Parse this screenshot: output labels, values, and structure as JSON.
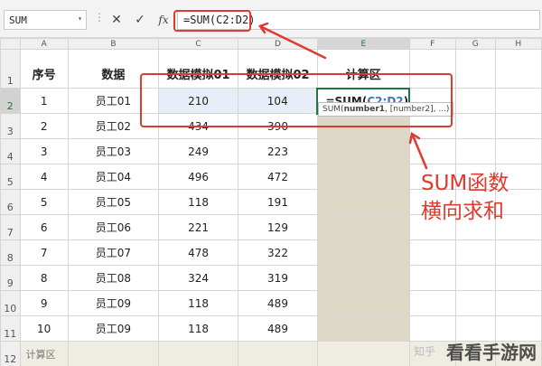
{
  "name_box": {
    "value": "SUM",
    "dropdown_icon": "▾"
  },
  "formula_bar": {
    "separator": "⋮",
    "cancel_icon": "✕",
    "enter_icon": "✓",
    "fx_icon": "fx",
    "formula": "=SUM(C2:D2)"
  },
  "columns": [
    "A",
    "B",
    "C",
    "D",
    "E",
    "F",
    "G",
    "H"
  ],
  "row_numbers": [
    "1",
    "2",
    "3",
    "4",
    "5",
    "6",
    "7",
    "8",
    "9",
    "10",
    "11"
  ],
  "sheet": {
    "headers": [
      "序号",
      "数据",
      "数据模拟01",
      "数据模拟02",
      "计算区"
    ],
    "rows": [
      {
        "a": "1",
        "b": "员工01",
        "c": "210",
        "d": "104"
      },
      {
        "a": "2",
        "b": "员工02",
        "c": "434",
        "d": "390"
      },
      {
        "a": "3",
        "b": "员工03",
        "c": "249",
        "d": "223"
      },
      {
        "a": "4",
        "b": "员工04",
        "c": "496",
        "d": "472"
      },
      {
        "a": "5",
        "b": "员工05",
        "c": "118",
        "d": "191"
      },
      {
        "a": "6",
        "b": "员工06",
        "c": "221",
        "d": "129"
      },
      {
        "a": "7",
        "b": "员工07",
        "c": "478",
        "d": "322"
      },
      {
        "a": "8",
        "b": "员工08",
        "c": "324",
        "d": "319"
      },
      {
        "a": "9",
        "b": "员工09",
        "c": "118",
        "d": "489"
      },
      {
        "a": "10",
        "b": "员工09",
        "c": "118",
        "d": "489"
      }
    ],
    "summary_row": {
      "number": "12",
      "label": "计算区"
    }
  },
  "active_cell": {
    "func": "=SUM(",
    "ref": "C2:D2",
    "close": ")"
  },
  "tooltip": {
    "func": "SUM(",
    "arg1": "number1",
    "rest": ", [number2], ...)"
  },
  "annotation": {
    "line1": "SUM函数",
    "line2": "横向求和"
  },
  "watermark": {
    "text": "看看手游网",
    "faint": "知乎"
  },
  "colors": {
    "annotation_red": "#e03a2f",
    "selection_green": "#217346",
    "ref_blue": "#4472c4",
    "calc_column": "#ddd7c5"
  }
}
